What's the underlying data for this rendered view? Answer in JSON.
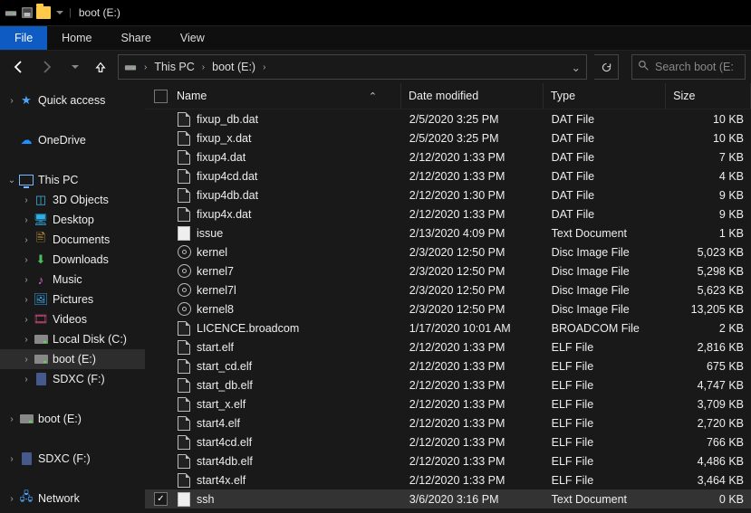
{
  "title_bar": {
    "app": "",
    "location": "boot (E:)"
  },
  "ribbon": {
    "file": "File",
    "home": "Home",
    "share": "Share",
    "view": "View"
  },
  "breadcrumb": {
    "segments": [
      "This PC",
      "boot (E:)"
    ]
  },
  "search": {
    "placeholder": "Search boot (E:"
  },
  "sidebar": {
    "quick_access": "Quick access",
    "onedrive": "OneDrive",
    "this_pc": "This PC",
    "items": [
      {
        "label": "3D Objects"
      },
      {
        "label": "Desktop"
      },
      {
        "label": "Documents"
      },
      {
        "label": "Downloads"
      },
      {
        "label": "Music"
      },
      {
        "label": "Pictures"
      },
      {
        "label": "Videos"
      },
      {
        "label": "Local Disk (C:)"
      },
      {
        "label": "boot (E:)"
      },
      {
        "label": "SDXC (F:)"
      }
    ],
    "boot": "boot (E:)",
    "sdxc": "SDXC (F:)",
    "network": "Network"
  },
  "columns": {
    "name": "Name",
    "date": "Date modified",
    "type": "Type",
    "size": "Size"
  },
  "rows": [
    {
      "icon": "file",
      "name": "fixup_db.dat",
      "date": "2/5/2020 3:25 PM",
      "type": "DAT File",
      "size": "10 KB"
    },
    {
      "icon": "file",
      "name": "fixup_x.dat",
      "date": "2/5/2020 3:25 PM",
      "type": "DAT File",
      "size": "10 KB"
    },
    {
      "icon": "file",
      "name": "fixup4.dat",
      "date": "2/12/2020 1:33 PM",
      "type": "DAT File",
      "size": "7 KB"
    },
    {
      "icon": "file",
      "name": "fixup4cd.dat",
      "date": "2/12/2020 1:33 PM",
      "type": "DAT File",
      "size": "4 KB"
    },
    {
      "icon": "file",
      "name": "fixup4db.dat",
      "date": "2/12/2020 1:30 PM",
      "type": "DAT File",
      "size": "9 KB"
    },
    {
      "icon": "file",
      "name": "fixup4x.dat",
      "date": "2/12/2020 1:33 PM",
      "type": "DAT File",
      "size": "9 KB"
    },
    {
      "icon": "txt",
      "name": "issue",
      "date": "2/13/2020 4:09 PM",
      "type": "Text Document",
      "size": "1 KB"
    },
    {
      "icon": "disc",
      "name": "kernel",
      "date": "2/3/2020 12:50 PM",
      "type": "Disc Image File",
      "size": "5,023 KB"
    },
    {
      "icon": "disc",
      "name": "kernel7",
      "date": "2/3/2020 12:50 PM",
      "type": "Disc Image File",
      "size": "5,298 KB"
    },
    {
      "icon": "disc",
      "name": "kernel7l",
      "date": "2/3/2020 12:50 PM",
      "type": "Disc Image File",
      "size": "5,623 KB"
    },
    {
      "icon": "disc",
      "name": "kernel8",
      "date": "2/3/2020 12:50 PM",
      "type": "Disc Image File",
      "size": "13,205 KB"
    },
    {
      "icon": "file",
      "name": "LICENCE.broadcom",
      "date": "1/17/2020 10:01 AM",
      "type": "BROADCOM File",
      "size": "2 KB"
    },
    {
      "icon": "file",
      "name": "start.elf",
      "date": "2/12/2020 1:33 PM",
      "type": "ELF File",
      "size": "2,816 KB"
    },
    {
      "icon": "file",
      "name": "start_cd.elf",
      "date": "2/12/2020 1:33 PM",
      "type": "ELF File",
      "size": "675 KB"
    },
    {
      "icon": "file",
      "name": "start_db.elf",
      "date": "2/12/2020 1:33 PM",
      "type": "ELF File",
      "size": "4,747 KB"
    },
    {
      "icon": "file",
      "name": "start_x.elf",
      "date": "2/12/2020 1:33 PM",
      "type": "ELF File",
      "size": "3,709 KB"
    },
    {
      "icon": "file",
      "name": "start4.elf",
      "date": "2/12/2020 1:33 PM",
      "type": "ELF File",
      "size": "2,720 KB"
    },
    {
      "icon": "file",
      "name": "start4cd.elf",
      "date": "2/12/2020 1:33 PM",
      "type": "ELF File",
      "size": "766 KB"
    },
    {
      "icon": "file",
      "name": "start4db.elf",
      "date": "2/12/2020 1:33 PM",
      "type": "ELF File",
      "size": "4,486 KB"
    },
    {
      "icon": "file",
      "name": "start4x.elf",
      "date": "2/12/2020 1:33 PM",
      "type": "ELF File",
      "size": "3,464 KB"
    },
    {
      "icon": "txt",
      "name": "ssh",
      "date": "3/6/2020 3:16 PM",
      "type": "Text Document",
      "size": "0 KB",
      "selected": true
    }
  ]
}
